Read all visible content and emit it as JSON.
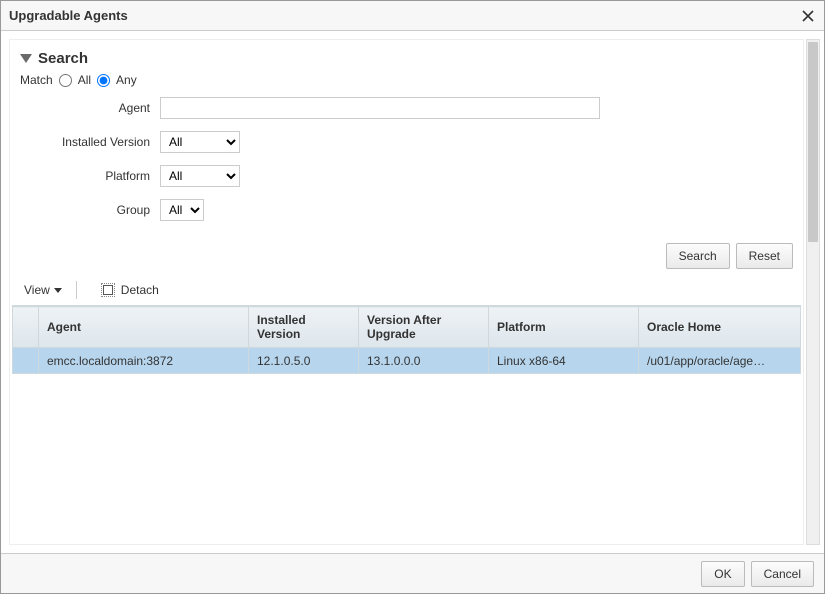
{
  "dialog": {
    "title": "Upgradable Agents"
  },
  "search": {
    "header": "Search",
    "match_label": "Match",
    "match_all_label": "All",
    "match_any_label": "Any",
    "match_selected": "any",
    "fields": {
      "agent_label": "Agent",
      "agent_value": "",
      "installed_version_label": "Installed Version",
      "installed_version_value": "All",
      "platform_label": "Platform",
      "platform_value": "All",
      "group_label": "Group",
      "group_value": "All"
    },
    "search_button": "Search",
    "reset_button": "Reset"
  },
  "toolbar": {
    "view_label": "View",
    "detach_label": "Detach"
  },
  "table": {
    "columns": {
      "agent": "Agent",
      "installed_version": "Installed Version",
      "version_after_upgrade": "Version After Upgrade",
      "platform": "Platform",
      "oracle_home": "Oracle Home"
    },
    "rows": [
      {
        "agent": "emcc.localdomain:3872",
        "installed_version": "12.1.0.5.0",
        "version_after_upgrade": "13.1.0.0.0",
        "platform": "Linux x86-64",
        "oracle_home": "/u01/app/oracle/age…"
      }
    ]
  },
  "footer": {
    "ok_label": "OK",
    "cancel_label": "Cancel"
  }
}
